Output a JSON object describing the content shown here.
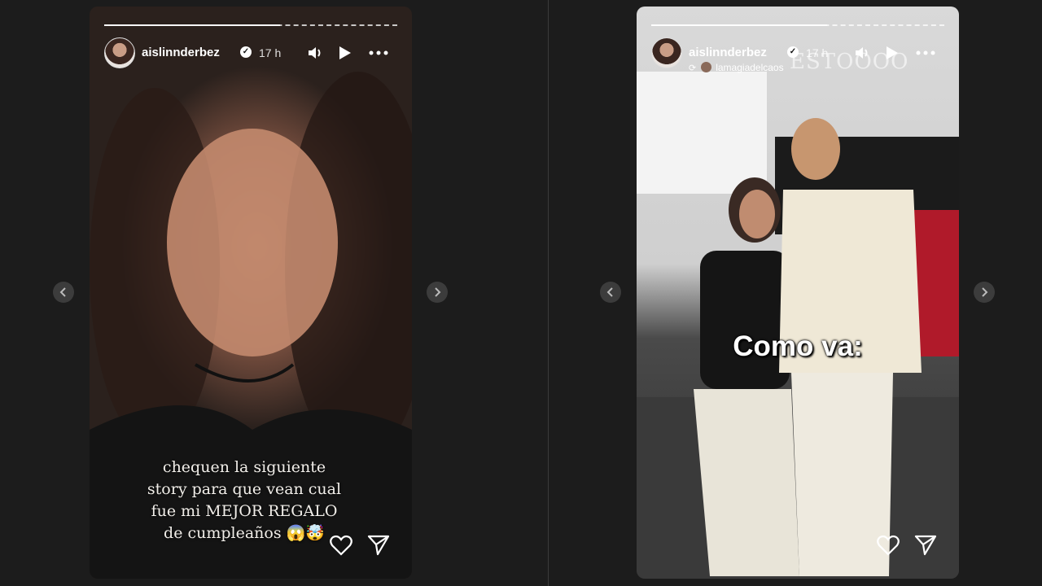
{
  "stories": [
    {
      "username": "aislinnderbez",
      "time": "17 h",
      "caption_lines": [
        "chequen la siguiente",
        "story para que vean cual",
        "fue mi MEJOR REGALO",
        "de cumpleaños 😱🤯"
      ],
      "progress": 0.6
    },
    {
      "username": "aislinnderbez",
      "time": "17 h",
      "reposted_from": "lamagiadelcaos",
      "overlay_text": "Como va:",
      "watermark": "ESTOOOO",
      "progress": 0.6
    }
  ],
  "icons": {
    "verified": "verified-badge-icon",
    "mute": "speaker-icon",
    "play": "play-icon",
    "more": "more-icon",
    "like": "heart-icon",
    "share": "send-icon",
    "prev": "chevron-left-icon",
    "next": "chevron-right-icon"
  }
}
